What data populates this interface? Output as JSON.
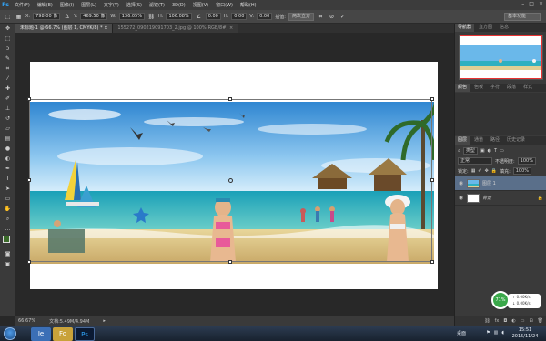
{
  "menubar": {
    "logo": "Ps",
    "items": [
      "文件(F)",
      "编辑(E)",
      "图像(I)",
      "图层(L)",
      "文字(Y)",
      "选择(S)",
      "滤镜(T)",
      "3D(D)",
      "视图(V)",
      "窗口(W)",
      "帮助(H)"
    ],
    "window_controls": [
      "–",
      "□",
      "×"
    ]
  },
  "options": {
    "x_label": "X:",
    "x_value": "798.00 像",
    "y_label": "Y:",
    "y_value": "469.50 像",
    "w_label": "W:",
    "w_value": "136.05%",
    "h_label": "H:",
    "h_value": "106.08%",
    "angle_value": "0.00",
    "h_skew_label": "H:",
    "h_skew_value": "0.00",
    "v_skew_label": "V:",
    "v_skew_value": "0.00",
    "interp_label": "插值:",
    "interp_value": "两次立方",
    "workspace": "基本功能"
  },
  "tabs": [
    {
      "label": "未标题-1 @ 66.7% (图层 1, CMYK/8) *",
      "close": "×",
      "active": true
    },
    {
      "label": "155272_090219091703_2.jpg @ 100%(RGB/8#)",
      "close": "×",
      "active": false
    }
  ],
  "status": {
    "zoom": "66.67%",
    "doc_info": "文档:5.49M/4.94M"
  },
  "panels": {
    "top_tabs": [
      "导航器",
      "直方图",
      "信息"
    ],
    "mid_tabs": [
      "颜色",
      "色板",
      "字符",
      "段落",
      "样式"
    ],
    "layers_tabs": [
      "图层",
      "通道",
      "路径",
      "历史记录"
    ],
    "filter_label": "类型",
    "blend_mode": "正常",
    "opacity_label": "不透明度:",
    "opacity_value": "100%",
    "lock_label": "锁定:",
    "fill_label": "填充:",
    "fill_value": "100%",
    "layers": [
      {
        "name": "图层 1",
        "selected": true
      },
      {
        "name": "背景",
        "selected": false,
        "locked": true
      }
    ]
  },
  "widget": {
    "percent": "71%",
    "up": "0.00K/s",
    "down": "0.00K/s"
  },
  "taskbar": {
    "apps": [
      "Ie",
      "Fo",
      "Ps"
    ],
    "desktop_label": "桌面",
    "time": "15:51",
    "date": "2015/11/24"
  },
  "colors": {
    "accent": "#31a8ff",
    "nav_frame": "#e83333",
    "layer_selected": "#5a6f8a",
    "widget_green": "#3aa84a"
  }
}
